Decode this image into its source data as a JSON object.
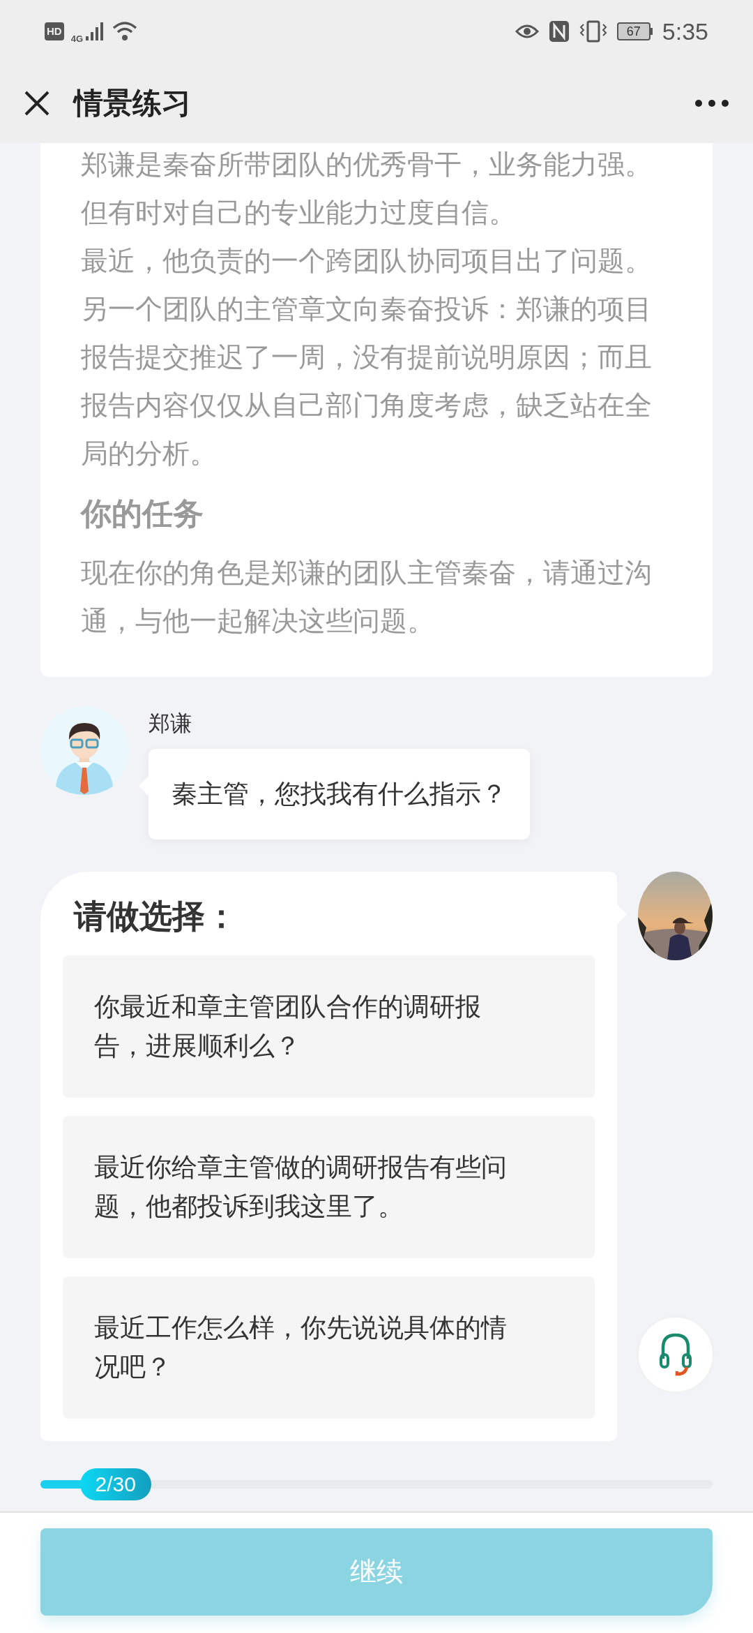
{
  "status_bar": {
    "hd": "HD",
    "network": "4G",
    "battery": "67",
    "time": "5:35"
  },
  "header": {
    "title": "情景练习"
  },
  "scenario": {
    "paragraphs": [
      "郑谦是秦奋所带团队的优秀骨干，业务能力强。但有时对自己的专业能力过度自信。",
      "最近，他负责的一个跨团队协同项目出了问题。另一个团队的主管章文向秦奋投诉：郑谦的项目报告提交推迟了一周，没有提前说明原因；而且报告内容仅仅从自己部门角度考虑，缺乏站在全局的分析。"
    ],
    "task_heading": "你的任务",
    "task_text": "现在你的角色是郑谦的团队主管秦奋，请通过沟通，与他一起解决这些问题。"
  },
  "messages": [
    {
      "sender": "郑谦",
      "text": "秦主管，您找我有什么指示？"
    }
  ],
  "choice": {
    "title": "请做选择：",
    "options": [
      {
        "text": "你最近和章主管团队合作的调研报告，进展顺利么？"
      },
      {
        "text": "最近你给章主管做的调研报告有些问题，他都投诉到我这里了。"
      },
      {
        "text": "最近工作怎么样，你先说说具体的情况吧？"
      }
    ]
  },
  "progress": {
    "label": "2/30",
    "level": 0.067
  },
  "continue_button": {
    "label": "继续",
    "disabled": true
  }
}
